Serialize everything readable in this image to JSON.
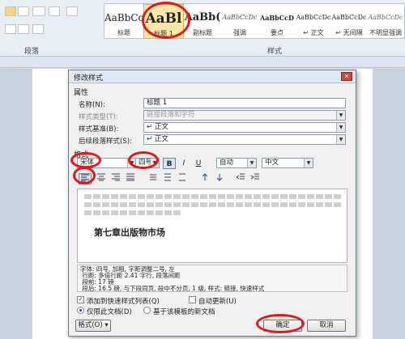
{
  "ribbon": {
    "paragraph_group_label": "段落",
    "styles_group_label": "样式",
    "styles": [
      {
        "preview": "AaBbCcDc",
        "label": "标题"
      },
      {
        "preview": "AaBl",
        "label": "标题 1"
      },
      {
        "preview": "AaBb(",
        "label": "副标题"
      },
      {
        "preview": "AaBbCcDc",
        "label": "强调"
      },
      {
        "preview": "AaBbCcD",
        "label": "要点"
      },
      {
        "preview": "AaBbCcDc",
        "label": "↵ 正文"
      },
      {
        "preview": "AaBbCcDc",
        "label": "↵ 无间隔"
      },
      {
        "preview": "AaBbCcDc",
        "label": "不明显强调"
      }
    ]
  },
  "dialog": {
    "title": "修改样式",
    "close_glyph": "✕",
    "properties_heading": "属性",
    "name_label": "名称(N):",
    "name_value": "标题 1",
    "style_type_label": "样式类型(T):",
    "style_type_value": "链接段落和字符",
    "based_on_label": "样式基准(B):",
    "based_on_value": "↵ 正文",
    "next_style_label": "后续段落样式(S):",
    "next_style_value": "↵ 正文",
    "format_heading": "格式",
    "font_value": "宋体",
    "size_value": "四号",
    "bold": "B",
    "italic": "I",
    "underline": "U",
    "color_value": "自动",
    "lang_value": "中文",
    "preview_heading": "第七章出版物市场",
    "description": "字体: 四号, 加粗, 字距调整二号, 左\n 行距: 多倍行距 2.41 字行, 段落间距\n 段前: 17 磅\n 段后: 16.5 磅, 与下段同页, 段中不分页, 1 级, 样式: 链接, 快速样式",
    "add_quick_label": "添加到快速样式列表(Q)",
    "auto_update_label": "自动更新(U)",
    "this_doc_label": "仅限此文档(D)",
    "template_label": "基于该模板的新文档",
    "format_button": "格式(O) ▾",
    "ok_button": "确定",
    "cancel_button": "取消"
  },
  "colors": {
    "annotation": "#e01818",
    "ribbon_bg": "#e9eef5",
    "dialog_bg": "#f0f0f0"
  }
}
